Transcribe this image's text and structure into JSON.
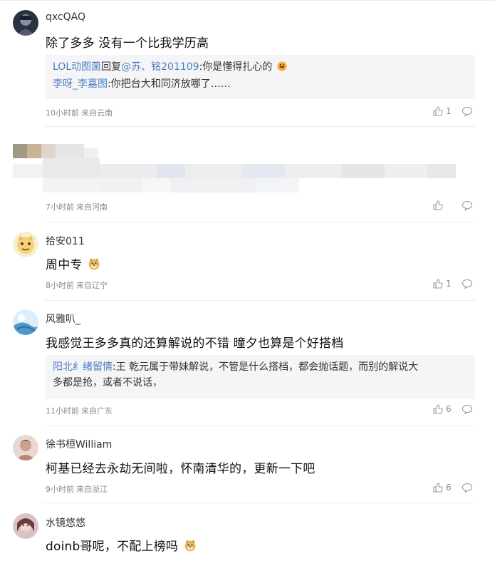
{
  "comments": [
    {
      "username": "qxcQAQ",
      "text": "除了多多 没有一个比我学历高",
      "quote": {
        "line1": {
          "user": "LOL动图菌",
          "middle": "回复",
          "target": "@苏、铭201109",
          "text": ":你是懂得扎心的"
        },
        "line2": {
          "user": "李呀_李嘉图",
          "text": ":你把台大和同济放哪了……"
        }
      },
      "time": "10小时前",
      "location": "来自云南",
      "likes": "1"
    },
    {
      "username": "",
      "text": "",
      "time": "7小时前",
      "location": "来自河南",
      "likes": ""
    },
    {
      "username": "拾安011",
      "text": "周中专",
      "time": "8小时前",
      "location": "来自辽宁",
      "likes": "1"
    },
    {
      "username": "风雅叭_",
      "text": "我感觉王多多真的还算解说的不错 曈夕也算是个好搭档",
      "quote": {
        "line1": {
          "user": "阳北纟绪留情",
          "text": ":王 乾元属于带妹解说，不管是什么搭档，都会抛话题，而别的解说大"
        },
        "line2": {
          "text": "多都是抢，或者不说话，"
        }
      },
      "time": "11小时前",
      "location": "来自广东",
      "likes": "6"
    },
    {
      "username": "徐书桓William",
      "text": "柯基已经去永劫无间啦，怀南清华的，更新一下吧",
      "time": "9小时前",
      "location": "来自浙江",
      "likes": "6"
    },
    {
      "username": "水镜悠悠",
      "text": "doinb哥呢，不配上榜吗"
    }
  ],
  "icons": {
    "like": "thumbs-up-icon",
    "reply": "comment-bubble-icon",
    "emoji_grin": "grinning-emoji",
    "emoji_doge": "doge-emoji"
  },
  "colors": {
    "link": "#4a7fc1",
    "quote_bg": "#f5f5f7",
    "meta": "#8a8a8a"
  }
}
